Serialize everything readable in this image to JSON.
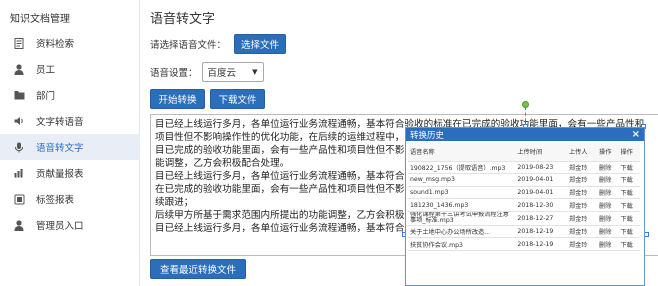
{
  "sidebar": {
    "title": "知识文档管理",
    "items": [
      {
        "label": "资料检索",
        "icon": "document-icon",
        "active": false
      },
      {
        "label": "员工",
        "icon": "user-icon",
        "active": false
      },
      {
        "label": "部门",
        "icon": "folder-icon",
        "active": false
      },
      {
        "label": "文字转语音",
        "icon": "speaker-icon",
        "active": false
      },
      {
        "label": "语音转文字",
        "icon": "microphone-icon",
        "active": true
      },
      {
        "label": "贡献量报表",
        "icon": "chart-icon",
        "active": false
      },
      {
        "label": "标签报表",
        "icon": "tag-icon",
        "active": false
      },
      {
        "label": "管理员入口",
        "icon": "admin-icon",
        "active": false
      }
    ]
  },
  "main": {
    "title": "语音转文字",
    "choose_label": "请选择语音文件：",
    "choose_button": "选择文件",
    "setting_label": "语音设置：",
    "setting_value": "百度云",
    "start_button": "开始转换",
    "download_button": "下载文件",
    "text_lines": [
      "目已经上线运行多月，各单位运行业务流程通畅，基本符合验收的标准在已完成的验收功能里面，会有一些产品性和",
      "项目性但不影响操作性的优化功能，在后续的运维过程中，",
      "目已完成的验收功能里面，会有一些产品性和项目性但不影",
      "能调整，乙方会积极配合处理。",
      "目已经上线运行多月，各单位运行业务流程通畅，基本符合验",
      "在已完成的验收功能里面，会有一些产品性和项目性但不影响",
      "续跟进；",
      "后续甲方所基于需求范围内所提出的功能调整，乙方会积极配",
      "目已经上线运行多月，各单位运行业务流程通畅，基本符合验"
    ],
    "history_button": "查看最近转换文件"
  },
  "modal": {
    "title": "转换历史",
    "close": "×",
    "columns": [
      "语音名称",
      "上传时间",
      "上传人",
      "操作",
      "操作"
    ],
    "rows": [
      {
        "name": "190822_1756（提取语音）.mp3",
        "date": "2019-08-23",
        "user": "郑金玲",
        "a1": "删除",
        "a2": "下载"
      },
      {
        "name": "new_msg.mp3",
        "date": "2019-04-01",
        "user": "郑金玲",
        "a1": "删除",
        "a2": "下载"
      },
      {
        "name": "sound1.mp3",
        "date": "2019-04-01",
        "user": "郑金玲",
        "a1": "删除",
        "a2": "下载"
      },
      {
        "name": "181230_1436.mp3",
        "date": "2018-12-30",
        "user": "郑金玲",
        "a1": "删除",
        "a2": "下载"
      },
      {
        "name": "强化课程第十三讲考试申报流程注意事项_标准.mp3",
        "date": "2018-12-27",
        "user": "郑金玲",
        "a1": "删除",
        "a2": "下载"
      },
      {
        "name": "关于土地中心办公场所改造...",
        "date": "2018-12-19",
        "user": "郑金玲",
        "a1": "删除",
        "a2": "下载"
      },
      {
        "name": "扶贫协作会议.mp3",
        "date": "2018-12-19",
        "user": "郑金玲",
        "a1": "删除",
        "a2": "下载"
      }
    ]
  },
  "colors": {
    "accent": "#2b6fba",
    "active_bg": "#e9eef6",
    "modal_head": "#2a6ebd"
  }
}
